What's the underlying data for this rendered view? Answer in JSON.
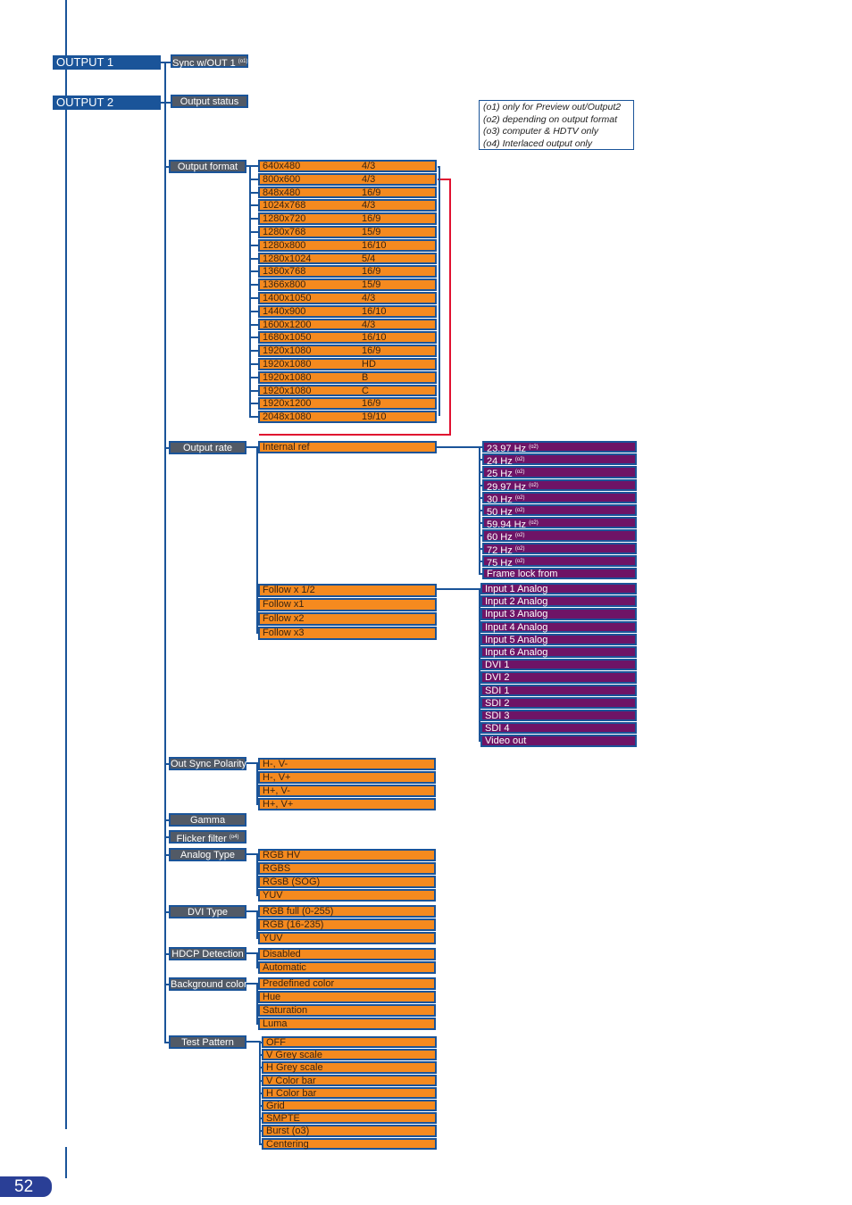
{
  "outputs": [
    "OUTPUT 1",
    "OUTPUT 2"
  ],
  "menu": {
    "sync": {
      "label": "Sync w/OUT 1",
      "note": "(o1)"
    },
    "output_status": "Output status",
    "output_format": "Output format",
    "output_rate": "Output rate",
    "out_sync_polarity": "Out Sync Polarity",
    "gamma": "Gamma",
    "flicker": {
      "label": "Flicker filter",
      "note": "(o4)"
    },
    "analog_type": "Analog Type",
    "dvi_type": "DVI Type",
    "hdcp": "HDCP Detection",
    "background": "Background color",
    "test_pattern": "Test Pattern"
  },
  "formats": [
    [
      "640x480",
      "4/3"
    ],
    [
      "800x600",
      "4/3"
    ],
    [
      "848x480",
      "16/9"
    ],
    [
      "1024x768",
      "4/3"
    ],
    [
      "1280x720",
      "16/9"
    ],
    [
      "1280x768",
      "15/9"
    ],
    [
      "1280x800",
      "16/10"
    ],
    [
      "1280x1024",
      "5/4"
    ],
    [
      "1360x768",
      "16/9"
    ],
    [
      "1366x800",
      "15/9"
    ],
    [
      "1400x1050",
      "4/3"
    ],
    [
      "1440x900",
      "16/10"
    ],
    [
      "1600x1200",
      "4/3"
    ],
    [
      "1680x1050",
      "16/10"
    ],
    [
      "1920x1080",
      "16/9"
    ],
    [
      "1920x1080",
      "HD"
    ],
    [
      "1920x1080",
      "B"
    ],
    [
      "1920x1080",
      "C"
    ],
    [
      "1920x1200",
      "16/9"
    ],
    [
      "2048x1080",
      "19/10"
    ]
  ],
  "internal_ref": "Internal ref",
  "rates": [
    "23.97 Hz",
    "24 Hz",
    "25 Hz",
    "29.97 Hz",
    "30 Hz",
    "50 Hz",
    "59.94 Hz",
    "60 Hz",
    "72 Hz",
    "75 Hz"
  ],
  "rate_note": "(o2)",
  "frame_lock": "Frame lock from",
  "follow": [
    "Follow x 1/2",
    "Follow x1",
    "Follow x2",
    "Follow x3"
  ],
  "sources": [
    "Input 1 Analog",
    "Input 2 Analog",
    "Input 3 Analog",
    "Input 4 Analog",
    "Input 5 Analog",
    "Input 6 Analog",
    "DVI 1",
    "DVI 2",
    "SDI 1",
    "SDI 2",
    "SDI 3",
    "SDI 4",
    "Video out"
  ],
  "polarity": [
    "H-, V-",
    "H-, V+",
    "H+, V-",
    "H+, V+"
  ],
  "analog": [
    "RGB HV",
    "RGBS",
    "RGsB (SOG)",
    "YUV"
  ],
  "dvi": [
    "RGB full (0-255)",
    "RGB       (16-235)",
    "YUV"
  ],
  "hdcp_opts": [
    "Disabled",
    "Automatic"
  ],
  "bg_opts": [
    "Predefined color",
    "Hue",
    "Saturation",
    "Luma"
  ],
  "patterns": [
    "OFF",
    "V Grey scale",
    "H Grey scale",
    "V Color bar",
    "H Color bar",
    "Grid",
    "SMPTE",
    "Burst (o3)",
    "Centering"
  ],
  "legend": [
    "(o1) only for Preview out/Output2",
    "(o2) depending on output format",
    "(o3) computer & HDTV only",
    "(o4) Interlaced output only"
  ],
  "page_number": "52",
  "colors": {
    "blue": "#1a5499",
    "grey": "#525a66",
    "orange": "#f58a1f",
    "purple": "#6e1466",
    "red": "#e01030"
  }
}
